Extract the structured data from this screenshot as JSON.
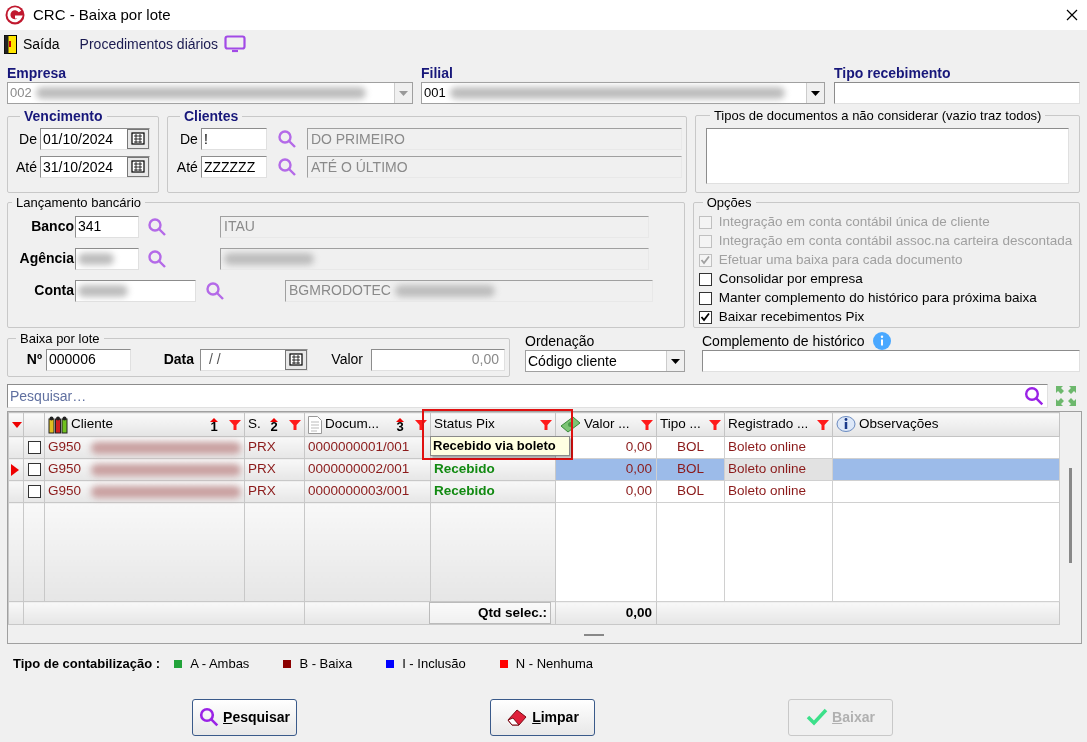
{
  "window": {
    "title": "CRC - Baixa por lote"
  },
  "toolbar": [
    {
      "label": "Saída"
    },
    {
      "label": "Procedimentos diários"
    }
  ],
  "empresa": {
    "label": "Empresa",
    "value": "002",
    "disabled": true
  },
  "filial": {
    "label": "Filial",
    "value": "001",
    "disabled": false
  },
  "tipo_recebimento": {
    "label": "Tipo recebimento"
  },
  "vencimento": {
    "title": "Vencimento",
    "rows": [
      {
        "label": "De",
        "value": "01/10/2024"
      },
      {
        "label": "Até",
        "value": "31/10/2024"
      }
    ]
  },
  "clientes": {
    "title": "Clientes",
    "rows": [
      {
        "label": "De",
        "code": "!",
        "name": "DO PRIMEIRO"
      },
      {
        "label": "Até",
        "code": "ZZZZZZ",
        "name": "ATÉ O ÚLTIMO"
      }
    ]
  },
  "tipos_documentos": {
    "title": "Tipos de documentos a não considerar (vazio traz todos)"
  },
  "lancamento": {
    "title": "Lançamento bancário",
    "rows": [
      {
        "label": "Banco",
        "code": "341",
        "name": "ITAU",
        "code_blurred": false,
        "name_blurred": false
      },
      {
        "label": "Agência",
        "code_blurred": true,
        "name_blurred": true
      },
      {
        "label": "Conta",
        "name": "BGMRODOTEC",
        "code_blurred": true,
        "name_blurred": true
      }
    ]
  },
  "opcoes": {
    "title": "Opções",
    "items": [
      {
        "label": "Integração em conta contábil única de cliente",
        "checked": false,
        "disabled": true
      },
      {
        "label": "Integração em conta contábil assoc.na carteira descontada",
        "checked": false,
        "disabled": true
      },
      {
        "label": "Efetuar uma baixa para cada documento",
        "checked": true,
        "disabled": true
      },
      {
        "label": "Consolidar por empresa",
        "checked": false,
        "disabled": false
      },
      {
        "label": "Manter complemento do histórico para próxima baixa",
        "checked": false,
        "disabled": false
      },
      {
        "label": "Baixar recebimentos Pix",
        "checked": true,
        "disabled": false
      }
    ]
  },
  "baixa_lote": {
    "title": "Baixa por lote",
    "numero": {
      "label": "Nº",
      "value": "000006"
    },
    "data": {
      "label": "Data",
      "value": "/ /"
    },
    "valor": {
      "label": "Valor",
      "value": "0,00"
    }
  },
  "ordenacao": {
    "label": "Ordenação",
    "value": "Código cliente"
  },
  "complemento": {
    "label": "Complemento de histórico"
  },
  "search": {
    "placeholder": "Pesquisar…"
  },
  "table": {
    "columns": [
      {
        "label": "Cliente",
        "sort": "1",
        "filter": true
      },
      {
        "label": "S.",
        "sort": "2",
        "filter": true
      },
      {
        "label": "Docum...",
        "sort": "3",
        "filter": true
      },
      {
        "label": "Status Pix",
        "filter": true
      },
      {
        "label": "Valor ...",
        "filter": true
      },
      {
        "label": "Tipo ...",
        "filter": true
      },
      {
        "label": "Registrado ...",
        "filter": true
      },
      {
        "label": "Observações",
        "filter": false
      }
    ],
    "rows": [
      {
        "selected": false,
        "checked": false,
        "cliente": "G950",
        "serie": "PRX",
        "documento": "0000000001/001",
        "valor": "0,00",
        "tipo": "BOL",
        "registrado": "Boleto online"
      },
      {
        "selected": true,
        "checked": false,
        "cliente": "G950",
        "serie": "PRX",
        "documento": "0000000002/001",
        "status_pix": "Recebido",
        "valor": "0,00",
        "tipo": "BOL",
        "registrado": "Boleto online"
      },
      {
        "selected": false,
        "checked": false,
        "cliente": "G950",
        "serie": "PRX",
        "documento": "0000000003/001",
        "status_pix": "Recebido",
        "valor": "0,00",
        "tipo": "BOL",
        "registrado": "Boleto online"
      }
    ],
    "footer": {
      "label": "Qtd selec.:",
      "total": "0,00"
    },
    "tooltip": {
      "text": "Recebido via boleto"
    }
  },
  "legend": {
    "label": "Tipo de contabilização :",
    "items": [
      {
        "label": "A - Ambas",
        "color": "#22a33a"
      },
      {
        "label": "B - Baixa",
        "color": "#8b0000"
      },
      {
        "label": "I - Inclusão",
        "color": "#0000ff"
      },
      {
        "label": "N - Nenhuma",
        "color": "#ff0000"
      }
    ]
  },
  "buttons": [
    {
      "label": "Pesquisar",
      "kind": "search",
      "disabled": false
    },
    {
      "label": "Limpar",
      "kind": "eraser",
      "disabled": false
    },
    {
      "label": "Baixar",
      "kind": "check",
      "disabled": true
    }
  ]
}
